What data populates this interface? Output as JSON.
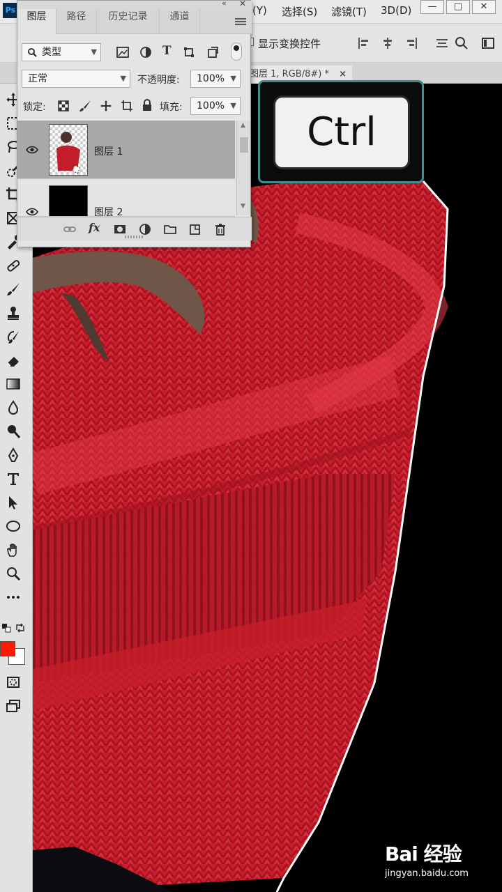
{
  "app": {
    "logo_text": "Ps",
    "menus": [
      "(Y)",
      "选择(S)",
      "滤镜(T)",
      "3D(D)"
    ]
  },
  "window_controls": [
    "—",
    "□",
    "✕"
  ],
  "options_bar": {
    "show_transform_label": "显示变换控件"
  },
  "document_tab": {
    "title": "图层 1, RGB/8#) *",
    "close": "×"
  },
  "layers_panel": {
    "tabs": [
      "图层",
      "路径",
      "历史记录",
      "通道"
    ],
    "filter_kind": "类型",
    "blend_mode": "正常",
    "opacity_label": "不透明度:",
    "opacity_value": "100%",
    "lock_label": "锁定:",
    "fill_label": "填充:",
    "fill_value": "100%",
    "layers": [
      {
        "name": "图层 1",
        "selected": true,
        "visible": true
      },
      {
        "name": "图层 2",
        "selected": false,
        "visible": true
      }
    ],
    "footer_icons": [
      "link-icon",
      "fx-icon",
      "mask-icon",
      "adjustment-icon",
      "folder-icon",
      "new-layer-icon",
      "trash-icon"
    ],
    "fx_label": "fx"
  },
  "tools": {
    "foreground_color": "#ff1a00",
    "background_color": "#ffffff"
  },
  "overlay": {
    "key_label": "Ctrl"
  },
  "watermark": {
    "brand": "Bai 经验",
    "url": "jingyan.baidu.com"
  }
}
